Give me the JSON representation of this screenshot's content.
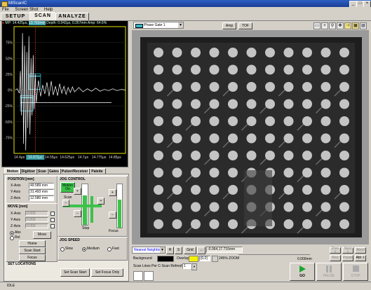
{
  "window": {
    "title": "MIScanIC",
    "buttons": [
      "_",
      "□",
      "×"
    ]
  },
  "menu": [
    "File",
    "Screen Shot",
    "Help"
  ],
  "main_tabs": [
    {
      "label": "SETUP",
      "active": false
    },
    {
      "label": "SCAN",
      "active": true
    },
    {
      "label": "ANALYZE",
      "active": false
    }
  ],
  "ascan": {
    "header_prefix": "MP: 14.425μs,",
    "header_highlight": "13.763mm",
    "header_rest": "Depth: 0.042μs, 0.267mm Amp: 64.6%",
    "y_ticks": [
      "75%",
      "50%",
      "25%",
      "0%",
      "-25%",
      "-50%",
      "-75%"
    ],
    "x_ticks": [
      "14.4μs",
      "14.475μs",
      "14.55μs",
      "14.625μs",
      "14.7μs",
      "14.775μs",
      "14.85μs"
    ],
    "highlight_x_index": 1
  },
  "chart_data": {
    "type": "line",
    "title": "",
    "xlabel": "",
    "ylabel": "",
    "ylim": [
      -100,
      100
    ],
    "xlim": [
      14.375,
      14.9
    ],
    "x_unit": "μs",
    "y_unit": "%",
    "series": [
      {
        "x": [
          14.38,
          14.39,
          14.4,
          14.405,
          14.41,
          14.415,
          14.42,
          14.425,
          14.43,
          14.435,
          14.44,
          14.445,
          14.45,
          14.455,
          14.46,
          14.465,
          14.47,
          14.475,
          14.48,
          14.49,
          14.5,
          14.51,
          14.52,
          14.53,
          14.54,
          14.55,
          14.56,
          14.57,
          14.58,
          14.59,
          14.6,
          14.61,
          14.62,
          14.63,
          14.64,
          14.65,
          14.66,
          14.68,
          14.7,
          14.72,
          14.74,
          14.76,
          14.78,
          14.8,
          14.82,
          14.84,
          14.86,
          14.88,
          14.9
        ],
        "y": [
          0,
          2,
          -5,
          30,
          -40,
          90,
          -85,
          70,
          -95,
          60,
          -60,
          85,
          -70,
          50,
          -40,
          55,
          -30,
          25,
          -20,
          15,
          -10,
          8,
          -6,
          12,
          -10,
          14,
          -8,
          6,
          -9,
          10,
          -5,
          6,
          -7,
          4,
          -4,
          5,
          -3,
          4,
          -3,
          2,
          -2,
          3,
          -2,
          1,
          -1,
          2,
          -1,
          1,
          0
        ]
      }
    ],
    "gates": [
      {
        "name": "gate-upper",
        "x_start": 14.445,
        "x_end": 14.5,
        "y": 22
      },
      {
        "name": "gate-lower",
        "x_start": 14.405,
        "x_end": 14.465,
        "y": -12
      }
    ],
    "threshold_y": -20,
    "cursor_x": 14.475
  },
  "sub_tabs": [
    {
      "label": "Motion",
      "active": true
    },
    {
      "label": "Digitizer",
      "active": false
    },
    {
      "label": "Scan",
      "active": false
    },
    {
      "label": "Gates",
      "active": false
    },
    {
      "label": "Pulser/Receiver",
      "active": false
    },
    {
      "label": "Palette",
      "active": false
    }
  ],
  "position": {
    "title": "POSITION [mm]",
    "x_label": "X-Axis",
    "x_value": "49.589 mm",
    "y_label": "Y-Axis",
    "y_value": "31.493 mm",
    "z_label": "Z-Axis",
    "z_value": "12.580 mm"
  },
  "move": {
    "title": "MOVE [mm]",
    "x_label": "X-Axis",
    "x_value": "0.000",
    "y_label": "Y-Axis",
    "y_value": "0.000",
    "z_label": "Z-Axis",
    "z_value": "0.000",
    "abs_label": "Abs",
    "rel_label": "Rel",
    "move_label": "Move",
    "home_label": "Home",
    "scan_start_label": "Scan Start",
    "focus_label": "Focus"
  },
  "jog": {
    "title": "JOG CONTROL",
    "motion_on_line1": "Motion",
    "motion_on_line2": "On",
    "scan_label": "Scan",
    "step_label": "Step",
    "focus_label": "Focus",
    "speed_title": "JOG SPEED",
    "slow_label": "Slow",
    "medium_label": "Medium",
    "fast_label": "Fast",
    "speed_selected": "medium"
  },
  "set_locations": {
    "title": "SET LOCATIONS",
    "scan_start_btn": "Set Scan Start",
    "focus_only_btn": "Set Focus Only"
  },
  "image_toolbar": {
    "gate_select": "Phase Gate 1",
    "gate_color": "#3ab5c6",
    "amp_label": "Amp",
    "tof_label": "TOF",
    "icons": [
      "select-icon",
      "crosshair-icon",
      "zoom-icon",
      "move-icon",
      "ruler-icon",
      "palette-icon",
      "grid-icon"
    ]
  },
  "bottom": {
    "interp_select": "Nearest Neighbor",
    "r_label": "R",
    "s_label": "S",
    "grid_label": "Grid",
    "coords": "-0.064,17.716mm",
    "background_label": "Background",
    "overlay_label": "Overlay",
    "overlay_value": "[0,0]",
    "zoom_text": "245% ZOOM",
    "scan_lines_label": "Scan Lines Per C-Scan Refresh",
    "scan_lines_value": "1",
    "readout_value": "0.000mm",
    "go_label": "GO",
    "pause_label": "PAUSE",
    "stop_label": "STOP",
    "small_btns": [
      "Prev ⇧",
      "Next ⇩",
      "Abort",
      "Res",
      "Pause",
      "Abt ⇩"
    ]
  },
  "status": {
    "state": "IDLE"
  }
}
